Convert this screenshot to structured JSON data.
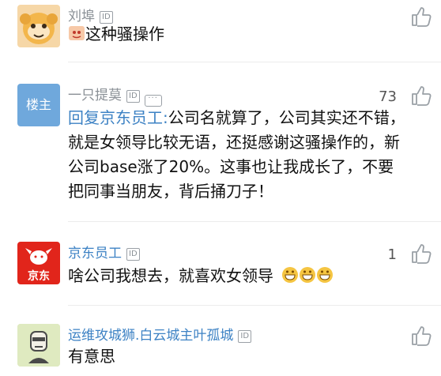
{
  "comments": [
    {
      "user_name": "刘埠",
      "id_badge": "ID",
      "text": "这种骚操作",
      "likes": ""
    },
    {
      "user_name": "一只提莫",
      "id_badge": "ID",
      "avatar_label": "楼主",
      "likes": "73",
      "reply_prefix": "回复京东员工:",
      "text": "公司名就算了，公司其实还不错，就是女领导比较无语，还挺感谢这骚操作的，新公司base涨了20%。这事也让我成长了，不要把同事当朋友，背后捅刀子！"
    },
    {
      "user_name": "京东员工",
      "id_badge": "ID",
      "avatar_label": "京东",
      "likes": "1",
      "text": "啥公司我想去，就喜欢女领导"
    },
    {
      "user_name": "运维攻城狮.白云城主叶孤城",
      "id_badge": "ID",
      "likes": "",
      "text": "有意思"
    }
  ],
  "colors": {
    "name": "#3d82c4",
    "name_muted": "#8a9096",
    "reply_prefix": "#3d82c4",
    "jd_red": "#e1251b",
    "louzhu_bg": "#6fa8dc"
  },
  "icons": {
    "like": "thumbs-up-icon",
    "message": "message-icon",
    "emoji": "grin-emoji-icon"
  }
}
